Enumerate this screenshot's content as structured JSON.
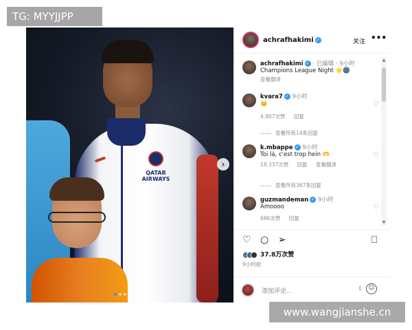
{
  "watermarks": {
    "top": "TG: MYYJJPP",
    "bottom": "www.wangjianshe.cn"
  },
  "photo": {
    "sponsor": "QATAR AIRWAYS",
    "next_icon": "chevron-right-icon"
  },
  "header": {
    "username": "achrafhakimi",
    "follow_label": "关注",
    "more_label": "•••"
  },
  "caption": {
    "username": "achrafhakimi",
    "edited": "· 已编辑 · 9小时",
    "text": "Champions League Night 🌟🌚",
    "translate": "查看翻译"
  },
  "comments": [
    {
      "username": "kvara7",
      "time": "9小时",
      "text": "👑",
      "likes": "4,907次赞",
      "reply": "回复",
      "translate": "",
      "view_replies": "查看所有14条回复"
    },
    {
      "username": "k.mbappe",
      "time": "9小时",
      "text": "Toi là, c'est trop hein 🫶",
      "likes": "18,337次赞",
      "reply": "回复",
      "translate": "查看翻译",
      "view_replies": "查看所有367条回复"
    },
    {
      "username": "guzmandeman",
      "time": "9小时",
      "text": "Amoooo",
      "likes": "686次赞",
      "reply": "回复",
      "translate": "",
      "view_replies": ""
    }
  ],
  "actions": {
    "like_icon": "heart-icon",
    "comment_icon": "comment-icon",
    "share_icon": "send-icon",
    "save_icon": "bookmark-icon"
  },
  "likes": {
    "count": "37.8万次赞"
  },
  "post_time": "9小时前",
  "add_comment": {
    "placeholder": "添加评论...",
    "emoji_icon": "smile-icon"
  }
}
